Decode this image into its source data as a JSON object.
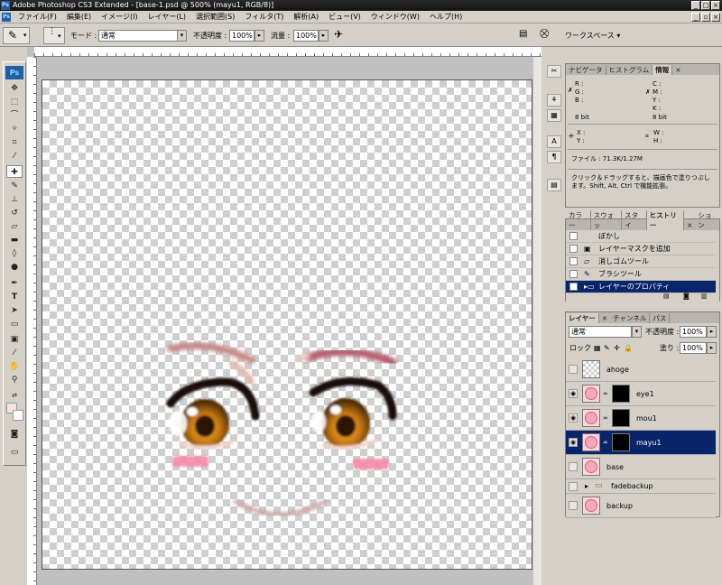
{
  "window": {
    "title": "Adobe Photoshop CS3 Extended - [base-1.psd @ 500% (mayu1, RGB/8)]"
  },
  "menu": [
    "ファイル(F)",
    "編集(E)",
    "イメージ(I)",
    "レイヤー(L)",
    "選択範囲(S)",
    "フィルタ(T)",
    "解析(A)",
    "ビュー(V)",
    "ウィンドウ(W)",
    "ヘルプ(H)"
  ],
  "options": {
    "mode_label": "モード :",
    "mode_value": "通常",
    "opacity_label": "不透明度 :",
    "opacity_value": "100%",
    "flow_label": "流量 :",
    "flow_value": "100%",
    "workspace_label": "ワークスペース ▾"
  },
  "info_panel": {
    "tabs": [
      "ナビゲータ",
      "ヒストグラム",
      "情報"
    ],
    "active_tab": "情報",
    "r": "R :",
    "g": "G :",
    "b": "B :",
    "c": "C :",
    "m": "M :",
    "y": "Y :",
    "k": "K :",
    "bit_left": "8 bit",
    "bit_right": "8 bit",
    "x": "X :",
    "y2": "Y :",
    "w": "W :",
    "h": "H :",
    "file": "ファイル : 71.3K/1.27M",
    "hint": "クリック＆ドラッグすると、描画色で塗りつぶします。Shift, Alt, Ctrl で機能拡張。"
  },
  "history_panel": {
    "tabs": [
      "カラー",
      "スウォッ",
      "スタイ",
      "ヒストリー",
      "ション"
    ],
    "items": [
      {
        "label": "ぼかし",
        "icon": "blur-icon"
      },
      {
        "label": "レイヤーマスクを追加",
        "icon": "mask-icon"
      },
      {
        "label": "消しゴムツール",
        "icon": "eraser-icon"
      },
      {
        "label": "ブラシツール",
        "icon": "brush-icon"
      },
      {
        "label": "レイヤーのプロパティ",
        "icon": "layer-props-icon"
      }
    ]
  },
  "layers_panel": {
    "tabs": [
      "レイヤー",
      "チャンネル",
      "パス"
    ],
    "blend_mode": "通常",
    "opacity_label": "不透明度 :",
    "opacity_value": "100%",
    "lock_label": "ロック :",
    "fill_label": "塗り :",
    "fill_value": "100%",
    "layers": [
      {
        "name": "ahoge",
        "visible": false
      },
      {
        "name": "eye1",
        "visible": true
      },
      {
        "name": "mou1",
        "visible": true
      },
      {
        "name": "mayu1",
        "visible": true,
        "selected": true
      },
      {
        "name": "base",
        "visible": false
      },
      {
        "name": "fadebackup",
        "visible": false
      },
      {
        "name": "backup",
        "visible": false
      }
    ]
  }
}
